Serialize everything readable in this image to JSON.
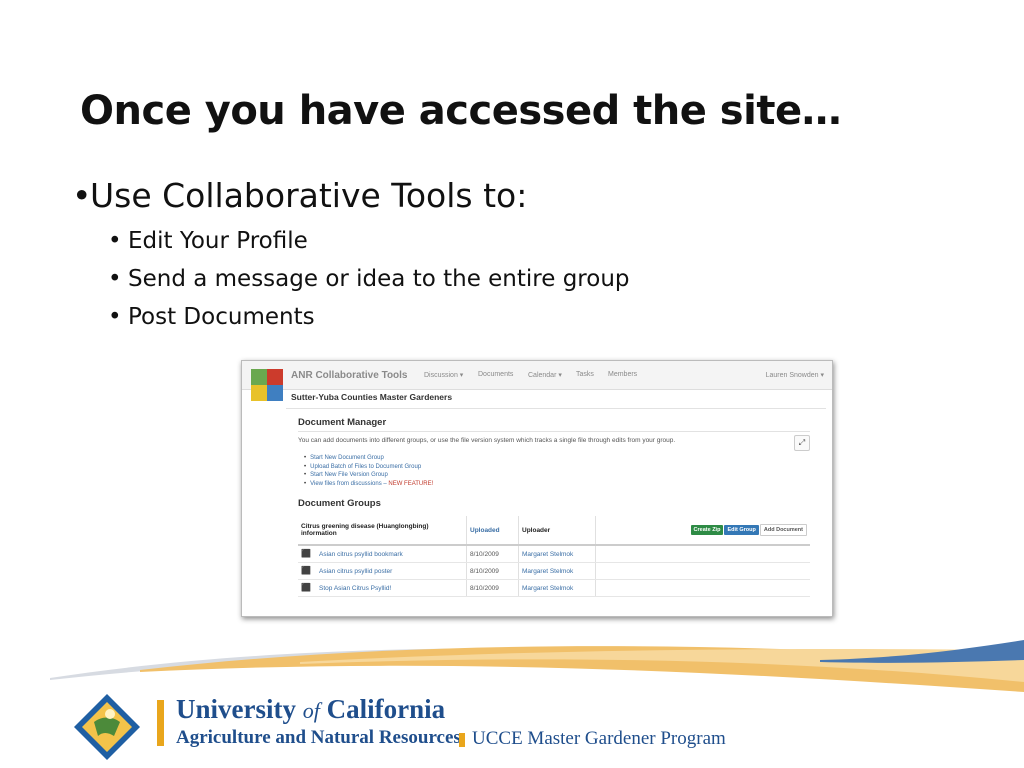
{
  "slide": {
    "title": "Once you have accessed the site…",
    "bullet": "Use Collaborative Tools to:",
    "sub_bullets": [
      "Edit Your Profile",
      "Send a message or idea to the entire group",
      "Post Documents"
    ]
  },
  "screenshot": {
    "app_name": "ANR Collaborative Tools",
    "nav": [
      "Discussion ▾",
      "Documents",
      "Calendar ▾",
      "Tasks",
      "Members"
    ],
    "user": "Lauren Snowden ▾",
    "group_name": "Sutter-Yuba Counties Master Gardeners",
    "doc_manager_heading": "Document Manager",
    "doc_manager_desc": "You can add documents into different groups, or use the file version system which tracks a single file through edits from your group.",
    "links": [
      "Start New Document Group",
      "Upload Batch of Files to Document Group",
      "Start New File Version Group",
      "View files from discussions –"
    ],
    "new_feature": "NEW FEATURE!",
    "doc_groups_heading": "Document Groups",
    "table": {
      "group_title": "Citrus greening disease (Huanglongbing) information",
      "col_uploaded": "Uploaded",
      "col_uploader": "Uploader",
      "buttons": [
        "Create Zip",
        "Edit Group",
        "Add Document"
      ],
      "rows": [
        {
          "name": "Asian citrus psyllid bookmark",
          "date": "8/10/2009",
          "uploader": "Margaret Stelmok"
        },
        {
          "name": "Asian citrus psyllid poster",
          "date": "8/10/2009",
          "uploader": "Margaret Stelmok"
        },
        {
          "name": "Stop Asian Citrus Psyllid!",
          "date": "8/10/2009",
          "uploader": "Margaret Stelmok"
        }
      ]
    }
  },
  "footer": {
    "uc_name_1": "University",
    "uc_name_of": "of",
    "uc_name_2": "California",
    "uc_sub": "Agriculture and Natural Resources",
    "program": "UCCE Master Gardener Program"
  },
  "colors": {
    "brand_blue": "#1f4e8c",
    "brand_gold": "#e9a61c",
    "link_blue": "#3a6ea5"
  }
}
